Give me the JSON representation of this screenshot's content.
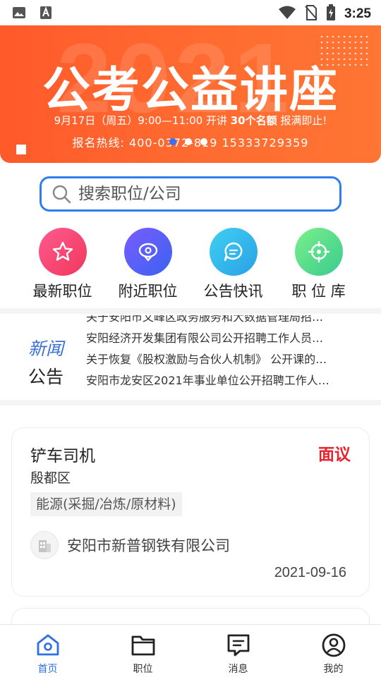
{
  "status_bar": {
    "time": "3:25",
    "left_icons": [
      "image-icon",
      "font-icon"
    ],
    "right_icons": [
      "wifi-icon",
      "no-sim-icon",
      "battery-icon"
    ]
  },
  "banner": {
    "bg_year": "2021",
    "title": "公考公益讲座",
    "info_prefix": "9月17日（周五）9:00—11:00 开讲",
    "info_quota": "30个名额",
    "info_suffix": "报满即止!",
    "hotline": "报名热线: 400-0372-819  15333729359",
    "pager_count": 3,
    "pager_active": 0
  },
  "search": {
    "placeholder": "搜索职位/公司"
  },
  "categories": [
    {
      "label": "最新职位",
      "icon": "star-icon",
      "color_from": "#ff4f8a",
      "color_to": "#f23a5e"
    },
    {
      "label": "附近职位",
      "icon": "location-icon",
      "color_from": "#6b5cff",
      "color_to": "#3a63f0"
    },
    {
      "label": "公告快讯",
      "icon": "chat-icon",
      "color_from": "#38c8f0",
      "color_to": "#2aa3e8"
    },
    {
      "label": "职 位 库",
      "icon": "target-icon",
      "color_from": "#6ef08a",
      "color_to": "#39cf8f"
    }
  ],
  "news": {
    "tag_line1": "新闻",
    "tag_line2": "公告",
    "items": [
      "关于安阳市文峰区政务服务和大数据管理局招…",
      "安阳经济开发集团有限公司公开招聘工作人员…",
      "关于恢复《股权激励与合伙人机制》 公开课的…",
      "安阳市龙安区2021年事业单位公开招聘工作人…"
    ]
  },
  "job": {
    "title": "铲车司机",
    "salary": "面议",
    "district": "殷都区",
    "tag": "能源(采掘/冶炼/原材料)",
    "company": "安阳市新普钢铁有限公司",
    "date": "2021-09-16"
  },
  "tabbar": [
    {
      "label": "首页",
      "icon": "home-icon",
      "active": true
    },
    {
      "label": "职位",
      "icon": "folder-icon",
      "active": false
    },
    {
      "label": "消息",
      "icon": "message-icon",
      "active": false
    },
    {
      "label": "我的",
      "icon": "profile-icon",
      "active": false
    }
  ],
  "colors": {
    "accent": "#2f6ee8",
    "banner": "#ff6a30",
    "salary": "#e8232d"
  }
}
